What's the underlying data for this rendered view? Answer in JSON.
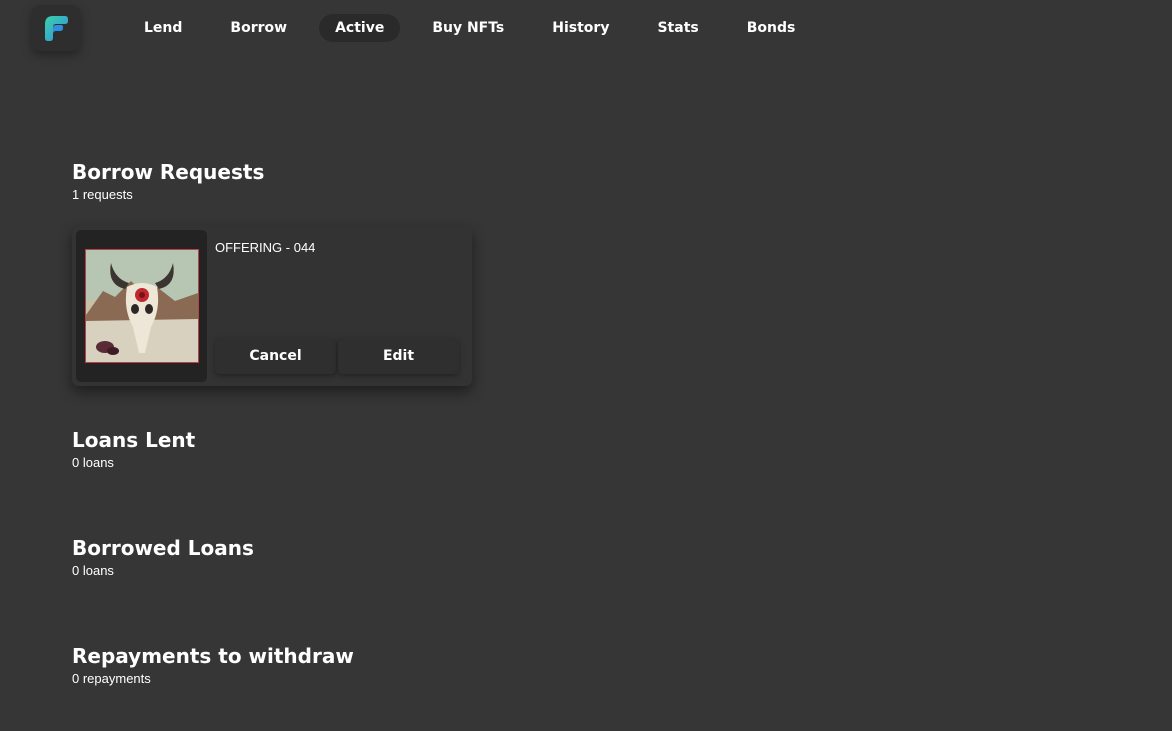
{
  "nav": {
    "logo_icon": "app-logo-icon",
    "items": [
      {
        "label": "Lend"
      },
      {
        "label": "Borrow"
      },
      {
        "label": "Active",
        "active": true
      },
      {
        "label": "Buy NFTs"
      },
      {
        "label": "History"
      },
      {
        "label": "Stats"
      },
      {
        "label": "Bonds"
      }
    ]
  },
  "borrow_requests": {
    "title": "Borrow Requests",
    "count": "1 requests",
    "items": [
      {
        "name": "OFFERING - 044",
        "image_icon": "nft-skull-artwork",
        "cancel_label": "Cancel",
        "edit_label": "Edit"
      }
    ]
  },
  "loans_lent": {
    "title": "Loans Lent",
    "count": "0 loans"
  },
  "borrowed_loans": {
    "title": "Borrowed Loans",
    "count": "0 loans"
  },
  "repayments": {
    "title": "Repayments to withdraw",
    "count": "0 repayments"
  },
  "colors": {
    "background": "#363636",
    "active_tab": "#2a2a2a",
    "logo_teal": "#3ed0a8",
    "logo_blue": "#2d8fe0"
  }
}
